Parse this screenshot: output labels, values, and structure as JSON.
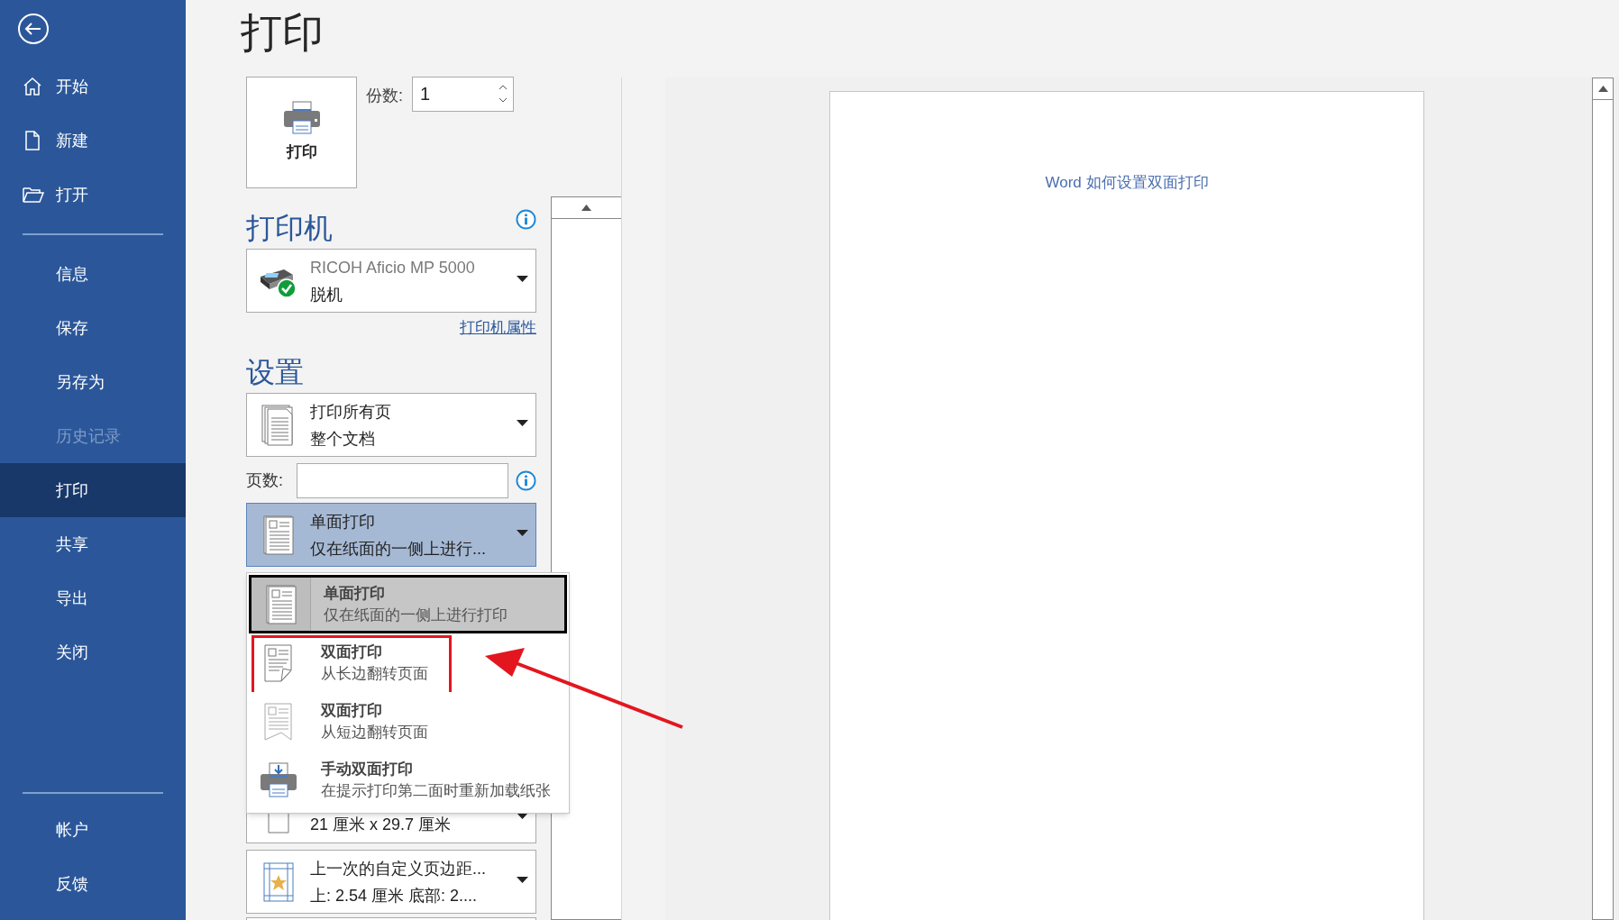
{
  "sidebar": {
    "top_items": [
      {
        "label": "开始",
        "selected": false,
        "disabled": false
      },
      {
        "label": "新建",
        "selected": false,
        "disabled": false
      },
      {
        "label": "打开",
        "selected": false,
        "disabled": false
      }
    ],
    "middle_items": [
      {
        "label": "信息",
        "selected": false,
        "disabled": false
      },
      {
        "label": "保存",
        "selected": false,
        "disabled": false
      },
      {
        "label": "另存为",
        "selected": false,
        "disabled": false
      },
      {
        "label": "历史记录",
        "selected": false,
        "disabled": true
      },
      {
        "label": "打印",
        "selected": true,
        "disabled": false
      },
      {
        "label": "共享",
        "selected": false,
        "disabled": false
      },
      {
        "label": "导出",
        "selected": false,
        "disabled": false
      },
      {
        "label": "关闭",
        "selected": false,
        "disabled": false
      }
    ],
    "bottom_items": [
      {
        "label": "帐户",
        "selected": false,
        "disabled": false
      },
      {
        "label": "反馈",
        "selected": false,
        "disabled": false
      }
    ]
  },
  "title": "打印",
  "print_button": {
    "label": "打印"
  },
  "copies": {
    "label": "份数:",
    "value": "1"
  },
  "printer": {
    "heading": "打印机",
    "name": "RICOH Aficio MP 5000",
    "status": "脱机",
    "properties_link": "打印机属性"
  },
  "settings": {
    "heading": "设置",
    "range_dropdown": {
      "title": "打印所有页",
      "subtitle": "整个文档"
    },
    "pages_field": {
      "label": "页数:"
    },
    "sides_dropdown": {
      "title": "单面打印",
      "subtitle": "仅在纸面的一侧上进行...",
      "open": true
    },
    "paper_dropdown": {
      "subtitle": "21 厘米 x 29.7 厘米"
    },
    "margins_dropdown": {
      "title": "上一次的自定义页边距...",
      "subtitle": "上: 2.54 厘米 底部: 2...."
    }
  },
  "sides_menu": [
    {
      "title": "单面打印",
      "subtitle": "仅在纸面的一侧上进行打印",
      "selected": true,
      "highlighted": false
    },
    {
      "title": "双面打印",
      "subtitle": "从长边翻转页面",
      "selected": false,
      "highlighted": true
    },
    {
      "title": "双面打印",
      "subtitle": "从短边翻转页面",
      "selected": false,
      "highlighted": false
    },
    {
      "title": "手动双面打印",
      "subtitle": "在提示打印第二面时重新加载纸张",
      "selected": false,
      "highlighted": false
    }
  ],
  "annotations": [
    {
      "kind": "arrow"
    }
  ],
  "preview": {
    "document_text": "Word 如何设置双面打印"
  }
}
